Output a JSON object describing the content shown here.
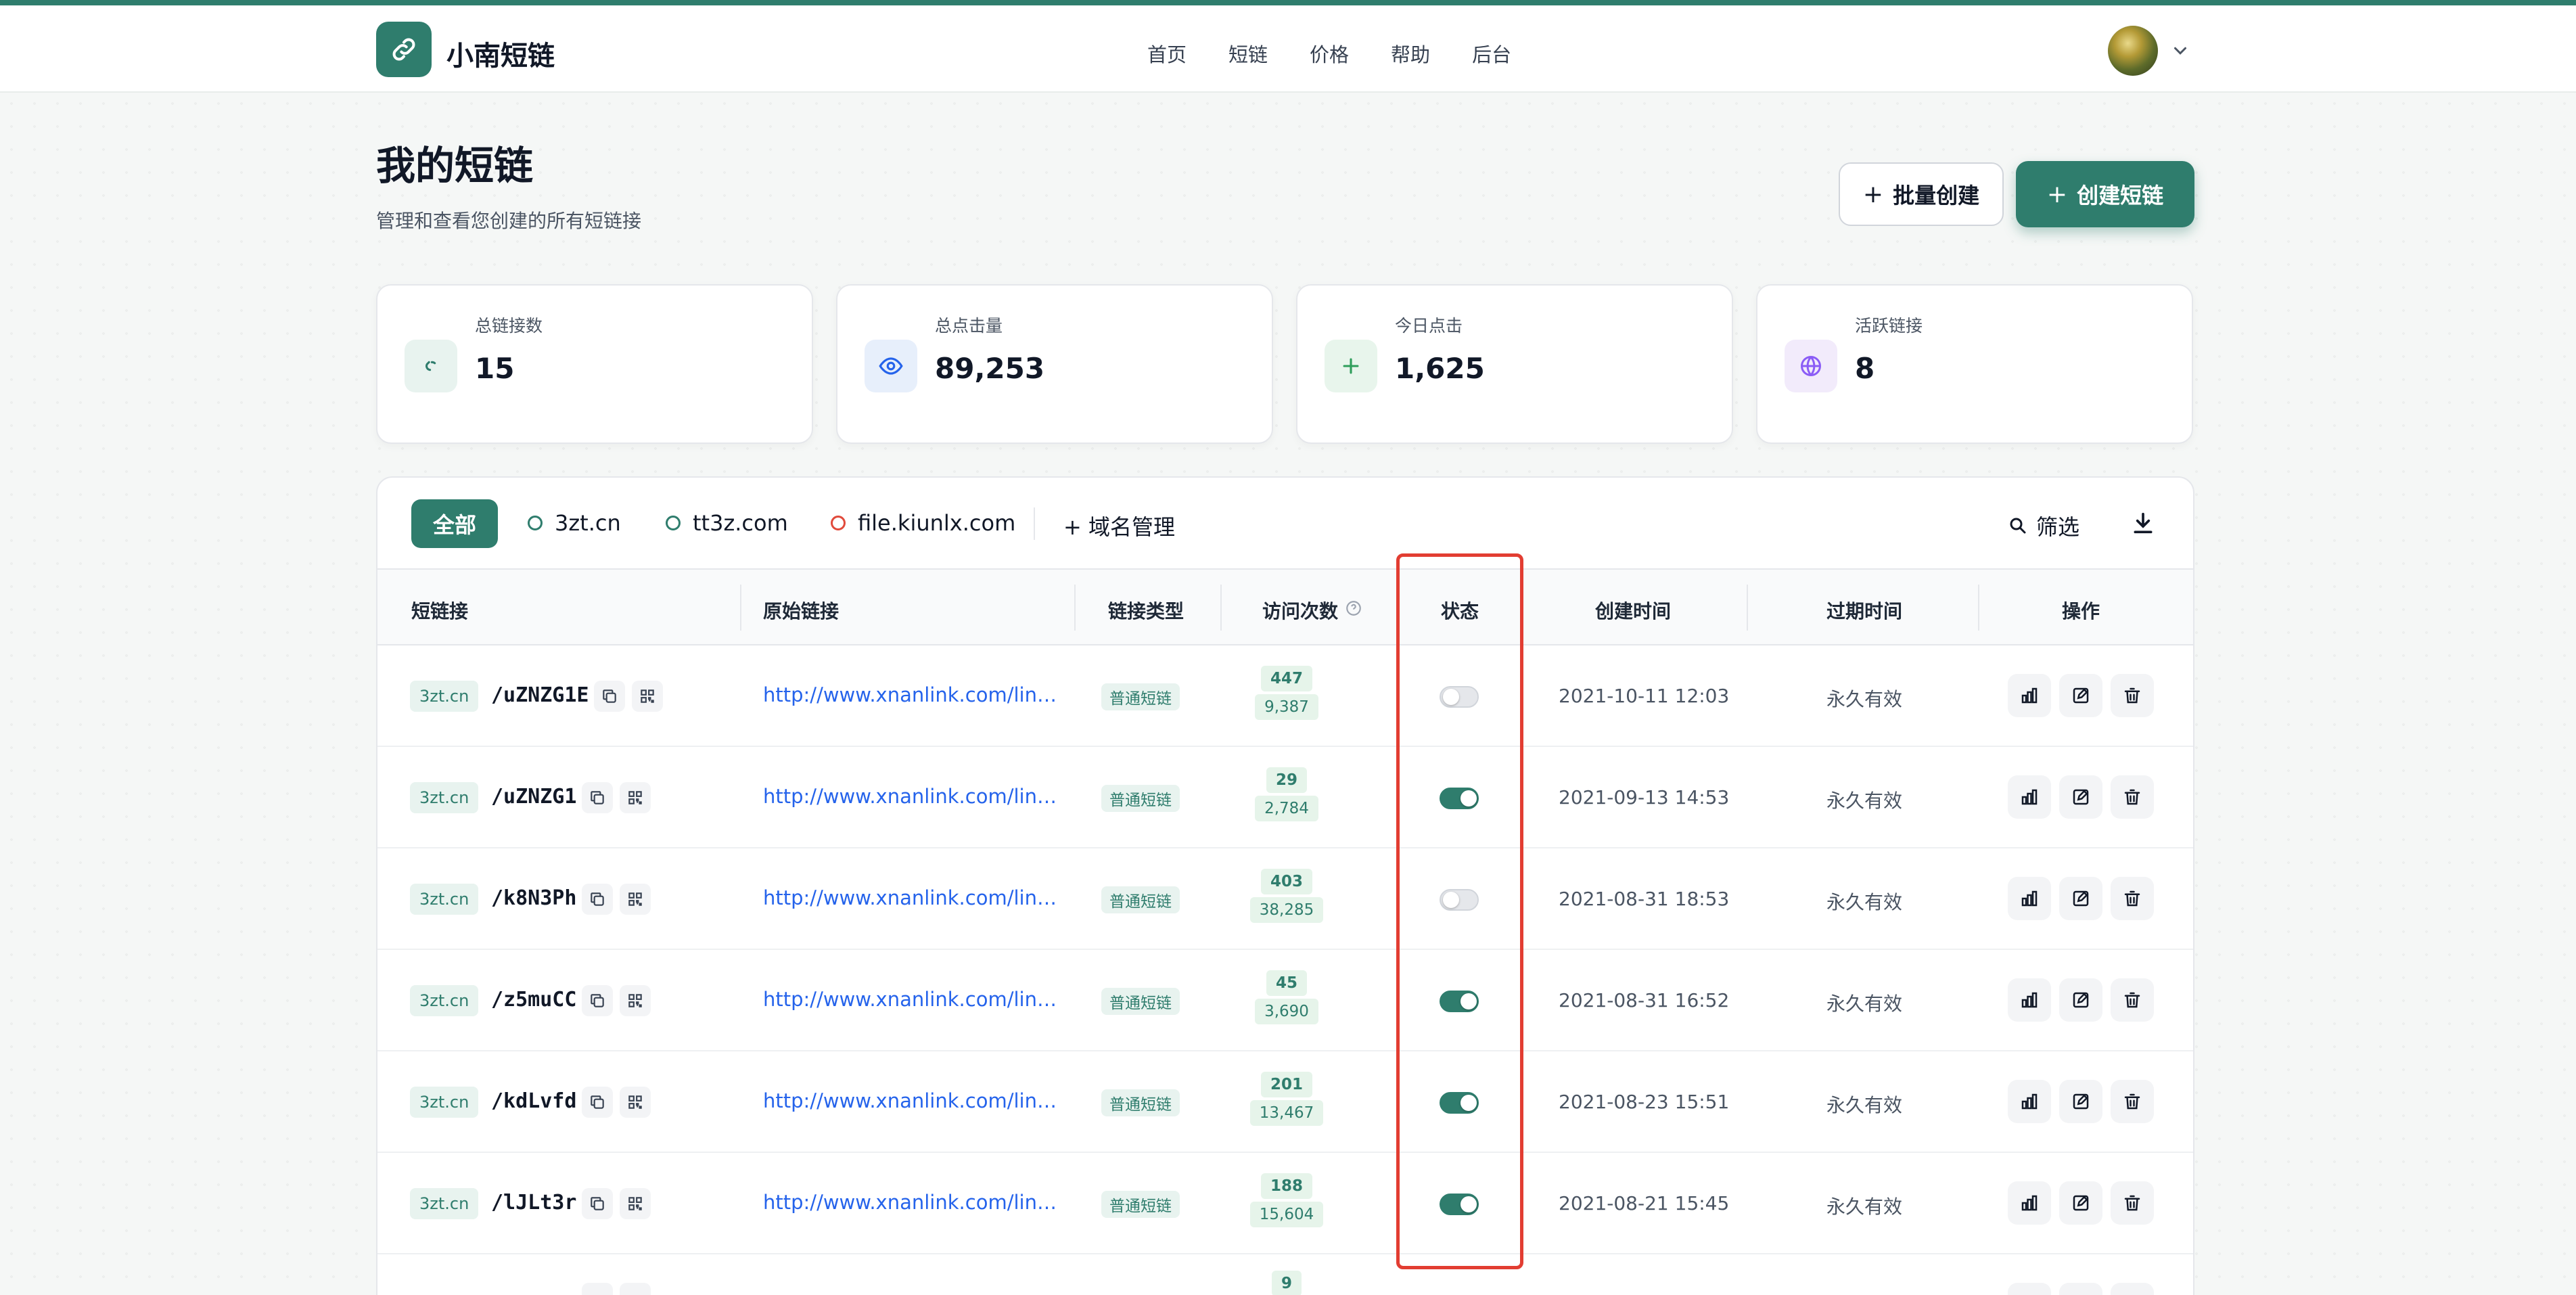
{
  "header": {
    "brand": "小南短链",
    "nav": [
      "首页",
      "短链",
      "价格",
      "帮助",
      "后台"
    ]
  },
  "page": {
    "title": "我的短链",
    "subtitle": "管理和查看您创建的所有短链接",
    "batch_create": "批量创建",
    "create": "创建短链"
  },
  "stats": [
    {
      "label": "总链接数",
      "value": "15",
      "icon": "link-icon"
    },
    {
      "label": "总点击量",
      "value": "89,253",
      "icon": "eye-icon"
    },
    {
      "label": "今日点击",
      "value": "1,625",
      "icon": "plus-icon"
    },
    {
      "label": "活跃链接",
      "value": "8",
      "icon": "globe-icon"
    }
  ],
  "tabs": {
    "all": "全部",
    "domains": [
      "3zt.cn",
      "tt3z.com",
      "file.kiunlx.com"
    ],
    "domain_manage": "+ 域名管理",
    "filter": "筛选"
  },
  "table": {
    "headers": [
      "短链接",
      "原始链接",
      "链接类型",
      "访问次数",
      "状态",
      "创建时间",
      "过期时间",
      "操作"
    ],
    "rows": [
      {
        "domain": "3zt.cn",
        "code": "/uZNZG1E",
        "url": "http://www.xnanlink.com/link/demo",
        "type": "普通短链",
        "today": "447",
        "total": "9,387",
        "enabled": false,
        "created": "2021-10-11 12:03",
        "expire": "永久有效"
      },
      {
        "domain": "3zt.cn",
        "code": "/uZNZG1",
        "url": "http://www.xnanlink.com/link/demo",
        "type": "普通短链",
        "today": "29",
        "total": "2,784",
        "enabled": true,
        "created": "2021-09-13 14:53",
        "expire": "永久有效"
      },
      {
        "domain": "3zt.cn",
        "code": "/k8N3Ph",
        "url": "http://www.xnanlink.com/link/demo",
        "type": "普通短链",
        "today": "403",
        "total": "38,285",
        "enabled": false,
        "created": "2021-08-31 18:53",
        "expire": "永久有效"
      },
      {
        "domain": "3zt.cn",
        "code": "/z5muCC",
        "url": "http://www.xnanlink.com/link/demo",
        "type": "普通短链",
        "today": "45",
        "total": "3,690",
        "enabled": true,
        "created": "2021-08-31 16:52",
        "expire": "永久有效"
      },
      {
        "domain": "3zt.cn",
        "code": "/kdLvfd",
        "url": "http://www.xnanlink.com/link/demo",
        "type": "普通短链",
        "today": "201",
        "total": "13,467",
        "enabled": true,
        "created": "2021-08-23 15:51",
        "expire": "永久有效"
      },
      {
        "domain": "3zt.cn",
        "code": "/lJLt3r",
        "url": "http://www.xnanlink.com/link/demo",
        "type": "普通短链",
        "today": "188",
        "total": "15,604",
        "enabled": true,
        "created": "2021-08-21 15:45",
        "expire": "永久有效"
      },
      {
        "domain": "",
        "code": "",
        "url": "",
        "type": "",
        "today": "9",
        "total": "",
        "enabled": false,
        "created": "",
        "expire": ""
      }
    ]
  },
  "colors": {
    "primary": "#2f7d6d",
    "link": "#2563eb",
    "highlight": "#e23d32"
  }
}
